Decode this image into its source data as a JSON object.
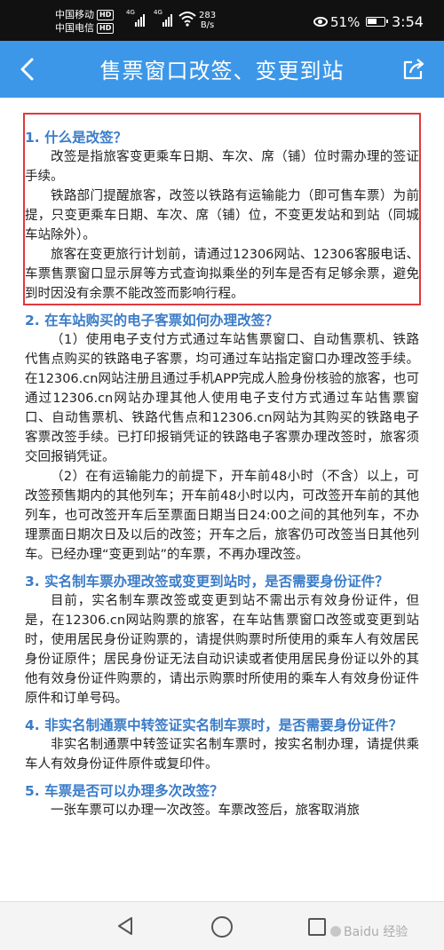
{
  "status_bar": {
    "carrier1": "中国移动",
    "carrier2": "中国电信",
    "hd": "HD",
    "signal_label": "4G",
    "net_speed": "283",
    "net_unit": "B/s",
    "battery": "51%",
    "time": "3:54"
  },
  "header": {
    "title": "售票窗口改签、变更到站"
  },
  "faq": [
    {
      "question": "1. 什么是改签？",
      "paragraphs": [
        "改签是指旅客变更乘车日期、车次、席（铺）位时需办理的签证手续。",
        "铁路部门提醒旅客，改签以铁路有运输能力（即可售车票）为前提，只变更乘车日期、车次、席（铺）位，不变更发站和到站（同城车站除外）。",
        "旅客在变更旅行计划前，请通过12306网站、12306客服电话、车票售票窗口显示屏等方式查询拟乘坐的列车是否有足够余票，避免到时因没有余票不能改签而影响行程。"
      ]
    },
    {
      "question": "2. 在车站购买的电子客票如何办理改签？",
      "paragraphs": [
        "（1）使用电子支付方式通过车站售票窗口、自动售票机、铁路代售点购买的铁路电子客票，均可通过车站指定窗口办理改签手续。在12306.cn网站注册且通过手机APP完成人脸身份核验的旅客，也可通过12306.cn网站办理其他人使用电子支付方式通过车站售票窗口、自动售票机、铁路代售点和12306.cn网站为其购买的铁路电子客票改签手续。已打印报销凭证的铁路电子客票办理改签时，旅客须交回报销凭证。",
        "（2）在有运输能力的前提下，开车前48小时（不含）以上，可改签预售期内的其他列车；开车前48小时以内，可改签开车前的其他列车，也可改签开车后至票面日期当日24:00之间的其他列车，不办理票面日期次日及以后的改签；开车之后，旅客仍可改签当日其他列车。已经办理“变更到站”的车票，不再办理改签。"
      ]
    },
    {
      "question": "3. 实名制车票办理改签或变更到站时，是否需要身份证件？",
      "paragraphs": [
        "目前，实名制车票改签或变更到站不需出示有效身份证件，但是，在12306.cn网站购票的旅客，在车站售票窗口改签或变更到站时，使用居民身份证购票的，请提供购票时所使用的乘车人有效居民身份证原件；居民身份证无法自动识读或者使用居民身份证以外的其他有效身份证件购票的，请出示购票时所使用的乘车人有效身份证件原件和订单号码。"
      ]
    },
    {
      "question": "4. 非实名制通票中转签证实名制车票时，是否需要身份证件？",
      "paragraphs": [
        "非实名制通票中转签证实名制车票时，按实名制办理，请提供乘车人有效身份证件原件或复印件。"
      ]
    },
    {
      "question": "5. 车票是否可以办理多次改签？",
      "paragraphs": [
        "一张车票可以办理一次改签。车票改签后，旅客取消旅"
      ]
    }
  ],
  "watermark": "Baidu 经验",
  "colors": {
    "title_bar": "#3c97e8",
    "question": "#3a7cc8",
    "highlight_border": "#e0383e"
  }
}
